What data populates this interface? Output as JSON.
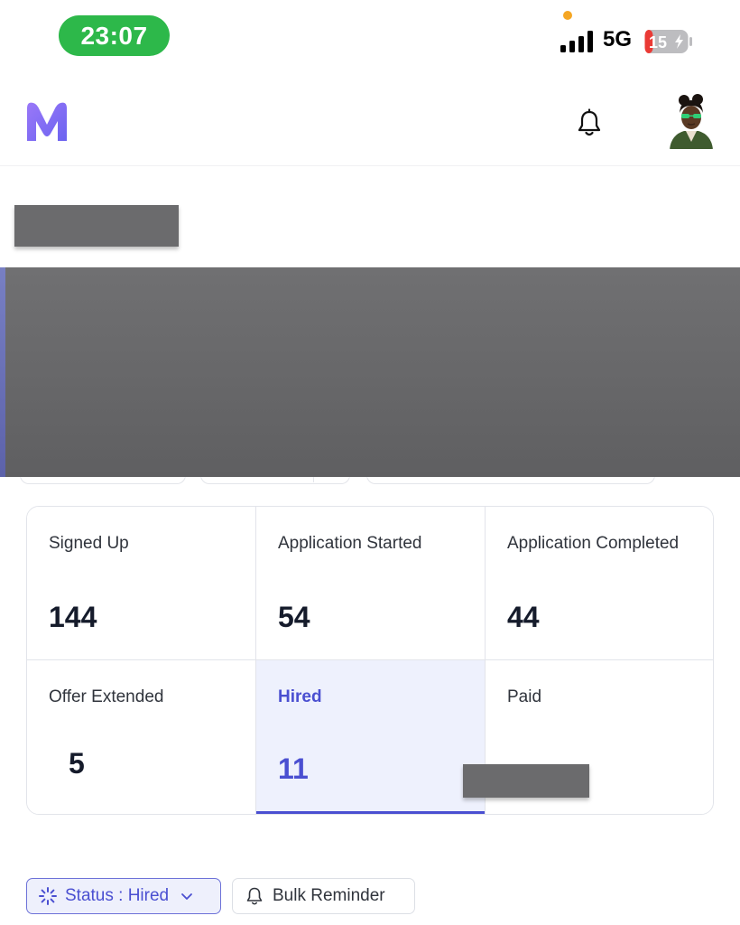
{
  "status_bar": {
    "time": "23:07",
    "network": "5G",
    "battery": "15"
  },
  "header": {
    "logo_letter": "M",
    "brand_color": "#7c6cf6"
  },
  "stats": [
    {
      "label": "Signed Up",
      "value": "144"
    },
    {
      "label": "Application Started",
      "value": "54"
    },
    {
      "label": "Application Completed",
      "value": "44"
    },
    {
      "label": "Offer Extended",
      "value": "5"
    },
    {
      "label": "Hired",
      "value": "11",
      "selected": true
    },
    {
      "label": "Paid",
      "value": ""
    }
  ],
  "filters": {
    "status_label": "Status : Hired",
    "bulk_reminder_label": "Bulk Reminder"
  },
  "colors": {
    "accent": "#4a4fd1",
    "status_pill": "#2db84a",
    "selected_bg": "#eef1fd"
  }
}
